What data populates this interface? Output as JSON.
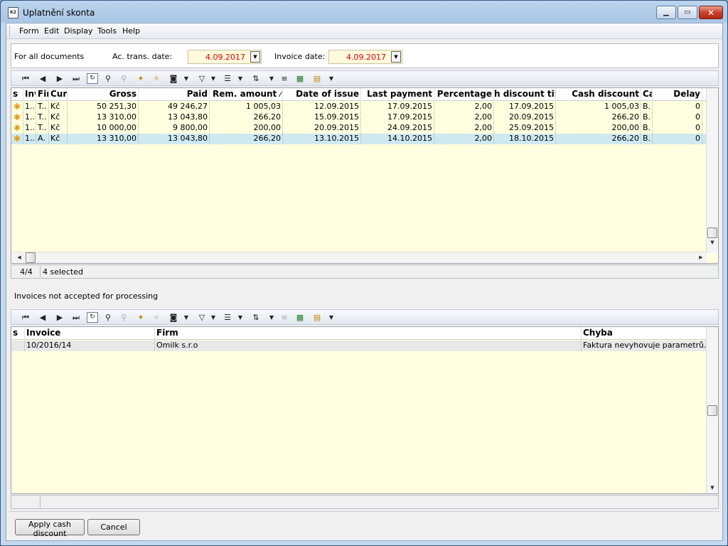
{
  "window": {
    "title": "Uplatnění skonta",
    "icon_text": "K2"
  },
  "menu": [
    "Form",
    "Edit",
    "Display",
    "Tools",
    "Help"
  ],
  "filters": {
    "for_all": "For all documents",
    "ac_date_label": "Ac. trans. date:",
    "ac_date_value": "4.09.2017",
    "inv_date_label": "Invoice date:",
    "inv_date_value": "4.09.2017"
  },
  "grid1": {
    "headers": [
      "s",
      "Inv",
      "Fir",
      "Curr",
      "Gross",
      "Paid",
      "Rem. amount",
      "Date of issue",
      "Last payment",
      "Percentage",
      "h discount till",
      "Cash discount",
      "Ca",
      "Delay"
    ],
    "rows": [
      [
        "1..",
        "T..",
        "Kč",
        "50 251,30",
        "49 246,27",
        "1 005,03",
        "12.09.2015",
        "17.09.2015",
        "2,00",
        "17.09.2015",
        "1 005,03",
        "B.",
        "0"
      ],
      [
        "1..",
        "T..",
        "Kč",
        "13 310,00",
        "13 043,80",
        "266,20",
        "15.09.2015",
        "17.09.2015",
        "2,00",
        "20.09.2015",
        "266,20",
        "B.",
        "0"
      ],
      [
        "1..",
        "T..",
        "Kč",
        "10 000,00",
        "9 800,00",
        "200,00",
        "20.09.2015",
        "24.09.2015",
        "2,00",
        "25.09.2015",
        "200,00",
        "B.",
        "0"
      ],
      [
        "1..",
        "A.",
        "Kč",
        "13 310,00",
        "13 043,80",
        "266,20",
        "13.10.2015",
        "14.10.2015",
        "2,00",
        "18.10.2015",
        "266,20",
        "B.",
        "0"
      ]
    ],
    "status_count": "4/4",
    "status_selected": "4 selected"
  },
  "section2_label": "Invoices not accepted for processing",
  "grid2": {
    "headers": [
      "s",
      "Invoice",
      "Firm",
      "Chyba"
    ],
    "rows": [
      [
        "",
        "10/2016/14",
        "Omilk s.r.o",
        "Faktura nevyhovuje parametrů…"
      ]
    ]
  },
  "buttons": {
    "apply": "Apply cash discount",
    "cancel": "Cancel"
  },
  "colors": {
    "grid_bg": "#ffffe0",
    "selected_row": "#cfe9f1",
    "date_text": "#e00000",
    "star": "#e89c12"
  }
}
